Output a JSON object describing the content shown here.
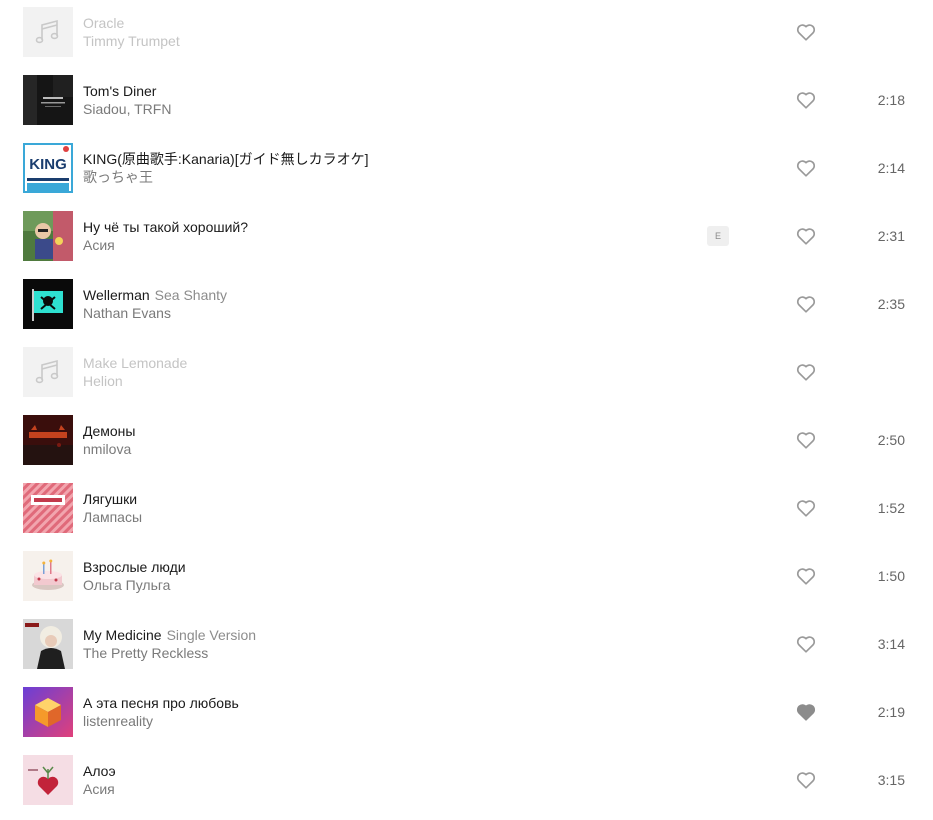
{
  "tracks": [
    {
      "title": "Oracle",
      "version": "",
      "artist": "Timmy Trumpet",
      "duration": "",
      "available": false,
      "liked": false,
      "explicit": false,
      "cover": "music-note-placeholder"
    },
    {
      "title": "Tom's Diner",
      "version": "",
      "artist": "Siadou, TRFN",
      "duration": "2:18",
      "available": true,
      "liked": false,
      "explicit": false,
      "cover": "toms-diner-cover"
    },
    {
      "title": "KING(原曲歌手:Kanaria)[ガイド無しカラオケ]",
      "version": "",
      "artist": "歌っちゃ王",
      "duration": "2:14",
      "available": true,
      "liked": false,
      "explicit": false,
      "cover": "king-karaoke-cover"
    },
    {
      "title": "Ну чё ты такой хороший?",
      "version": "",
      "artist": "Асия",
      "duration": "2:31",
      "available": true,
      "liked": false,
      "explicit": true,
      "explicit_label": "E",
      "cover": "asiya-cover"
    },
    {
      "title": "Wellerman",
      "version": "Sea Shanty",
      "artist": "Nathan Evans",
      "duration": "2:35",
      "available": true,
      "liked": false,
      "explicit": false,
      "cover": "wellerman-cover"
    },
    {
      "title": "Make Lemonade",
      "version": "",
      "artist": "Helion",
      "duration": "",
      "available": false,
      "liked": false,
      "explicit": false,
      "cover": "music-note-placeholder"
    },
    {
      "title": "Демоны",
      "version": "",
      "artist": "nmilova",
      "duration": "2:50",
      "available": true,
      "liked": false,
      "explicit": false,
      "cover": "demony-cover"
    },
    {
      "title": "Лягушки",
      "version": "",
      "artist": "Лампасы",
      "duration": "1:52",
      "available": true,
      "liked": false,
      "explicit": false,
      "cover": "lyagushki-cover"
    },
    {
      "title": "Взрослые люди",
      "version": "",
      "artist": "Ольга Пульга",
      "duration": "1:50",
      "available": true,
      "liked": false,
      "explicit": false,
      "cover": "cake-cover"
    },
    {
      "title": "My Medicine",
      "version": "Single Version",
      "artist": "The Pretty Reckless",
      "duration": "3:14",
      "available": true,
      "liked": false,
      "explicit": false,
      "cover": "pretty-reckless-cover"
    },
    {
      "title": "А эта песня про любовь",
      "version": "",
      "artist": "listenreality",
      "duration": "2:19",
      "available": true,
      "liked": true,
      "explicit": false,
      "cover": "cube-cover"
    },
    {
      "title": "Алоэ",
      "version": "",
      "artist": "Асия",
      "duration": "3:15",
      "available": true,
      "liked": false,
      "explicit": false,
      "cover": "aloe-heart-cover"
    }
  ],
  "colors": {
    "heart_outline": "#9a9a9a",
    "heart_filled": "#8c8c8c"
  }
}
